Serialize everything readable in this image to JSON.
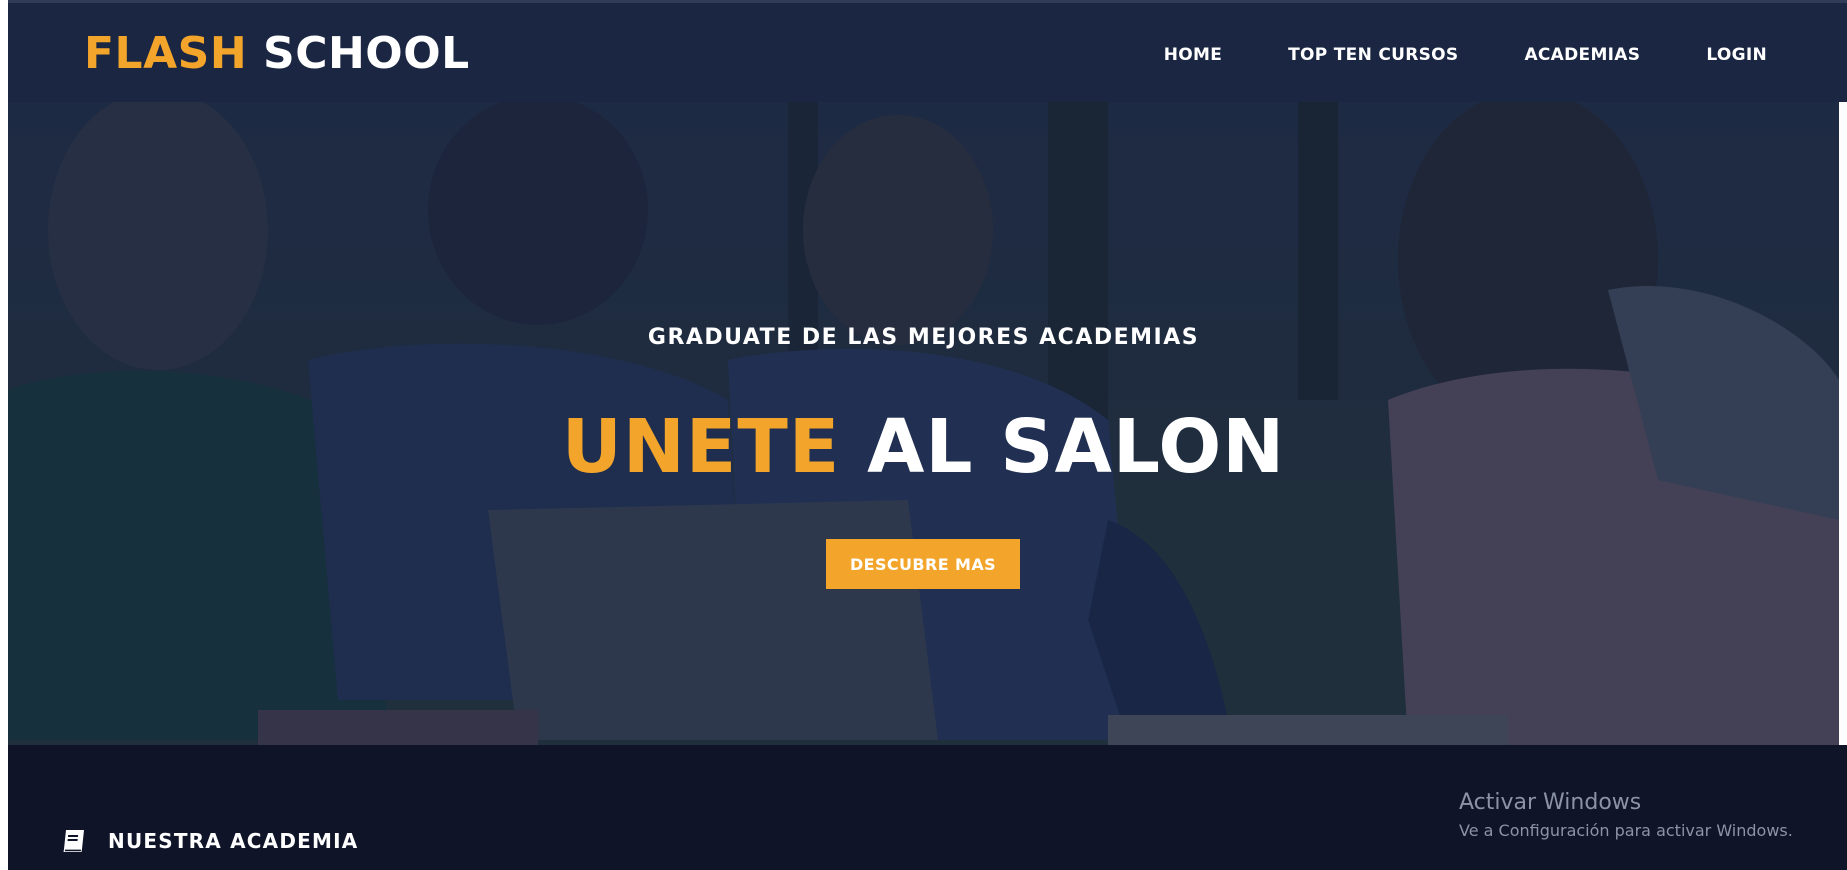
{
  "header": {
    "logo": {
      "accent": "FLASH",
      "rest": "SCHOOL"
    },
    "nav": [
      {
        "label": "HOME"
      },
      {
        "label": "TOP TEN CURSOS"
      },
      {
        "label": "ACADEMIAS"
      },
      {
        "label": "LOGIN"
      }
    ]
  },
  "hero": {
    "subtitle": "GRADUATE DE LAS MEJORES ACADEMIAS",
    "title_accent": "UNETE",
    "title_rest": "AL SALON",
    "button_label": "DESCUBRE MAS"
  },
  "section": {
    "icon": "book-icon",
    "heading": "NUESTRA ACADEMIA"
  },
  "watermark": {
    "title": "Activar Windows",
    "subtitle": "Ve a Configuración para activar Windows."
  },
  "colors": {
    "navbar": "#1b2642",
    "accent": "#f2a52a",
    "footer": "#0f1429",
    "text": "#ffffff"
  }
}
